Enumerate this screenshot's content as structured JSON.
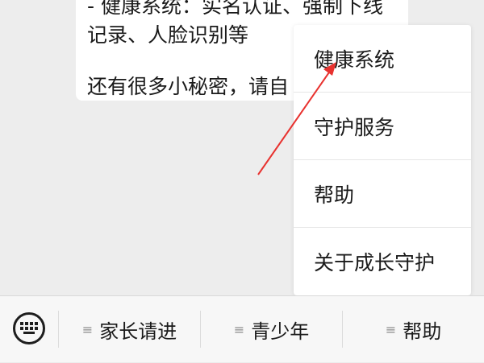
{
  "chat": {
    "lines": [
      "- 健康系统：实名认证、强制下线",
      "记录、人脸识别等",
      "还有很多小秘密，请自"
    ]
  },
  "menu": {
    "items": [
      {
        "label": "健康系统"
      },
      {
        "label": "守护服务"
      },
      {
        "label": "帮助"
      },
      {
        "label": "关于成长守护"
      }
    ]
  },
  "bottom_bar": {
    "keyboard_icon": "keyboard-icon",
    "tabs": [
      {
        "label": "家长请进",
        "icon": "menu-lines-icon"
      },
      {
        "label": "青少年",
        "icon": "menu-lines-icon"
      },
      {
        "label": "帮助",
        "icon": "menu-lines-icon"
      }
    ]
  },
  "annotation": {
    "color": "#e8322f"
  }
}
